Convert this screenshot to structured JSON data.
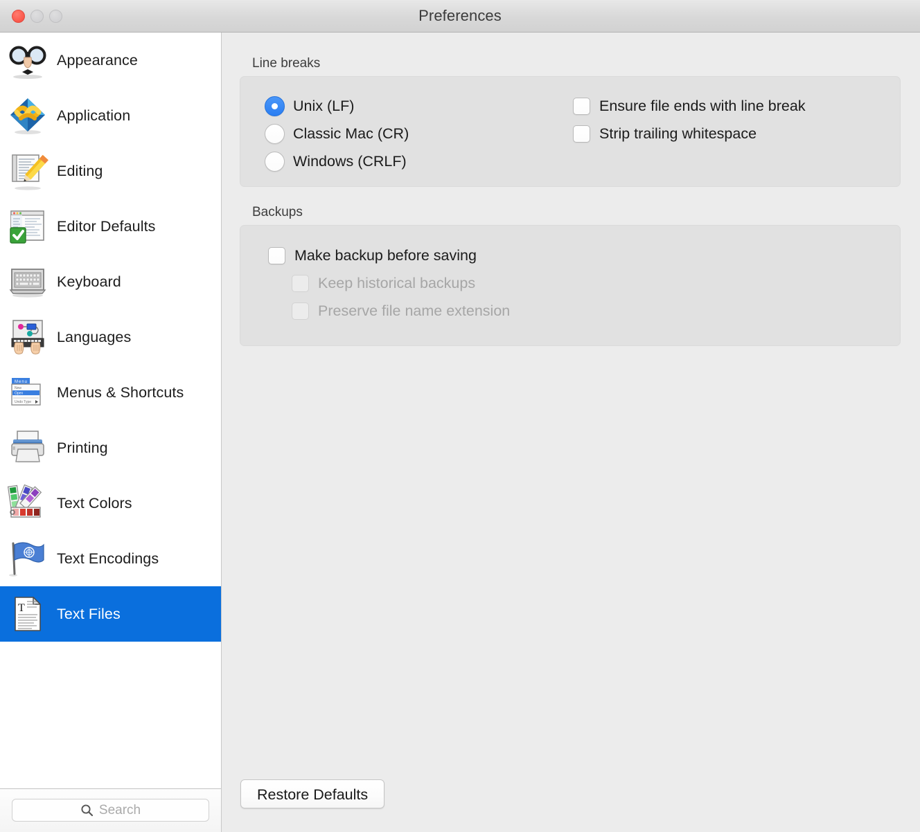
{
  "window": {
    "title": "Preferences",
    "traffic_lights": [
      {
        "name": "close",
        "color": "#fc5f52",
        "enabled": true
      },
      {
        "name": "minimize",
        "color": "#d4d4d6",
        "enabled": false
      },
      {
        "name": "zoom",
        "color": "#d4d4d6",
        "enabled": false
      }
    ]
  },
  "sidebar": {
    "selected_index": 10,
    "items": [
      {
        "label": "Appearance",
        "icon": "glasses-nose-icon"
      },
      {
        "label": "Application",
        "icon": "knot-diamond-icon"
      },
      {
        "label": "Editing",
        "icon": "pencil-document-icon"
      },
      {
        "label": "Editor Defaults",
        "icon": "window-checkmark-icon"
      },
      {
        "label": "Keyboard",
        "icon": "keyboard-icon"
      },
      {
        "label": "Languages",
        "icon": "hands-typing-icon"
      },
      {
        "label": "Menus & Shortcuts",
        "icon": "menu-dropdown-icon"
      },
      {
        "label": "Printing",
        "icon": "printer-icon"
      },
      {
        "label": "Text Colors",
        "icon": "color-swatches-icon"
      },
      {
        "label": "Text Encodings",
        "icon": "un-flag-icon"
      },
      {
        "label": "Text Files",
        "icon": "text-document-icon"
      }
    ],
    "selection_color": "#0a6fdd",
    "search": {
      "placeholder": "Search",
      "value": "",
      "icon": "search-icon"
    }
  },
  "main": {
    "sections": [
      {
        "title": "Line breaks",
        "radio_group": {
          "name": "line-break-style",
          "options": [
            {
              "label": "Unix (LF)",
              "checked": true
            },
            {
              "label": "Classic Mac (CR)",
              "checked": false
            },
            {
              "label": "Windows (CRLF)",
              "checked": false
            }
          ]
        },
        "checkboxes": [
          {
            "label": "Ensure file ends with line break",
            "checked": false,
            "enabled": true
          },
          {
            "label": "Strip trailing whitespace",
            "checked": false,
            "enabled": true
          }
        ]
      },
      {
        "title": "Backups",
        "checkboxes": [
          {
            "label": "Make backup before saving",
            "checked": false,
            "enabled": true,
            "indent": false
          },
          {
            "label": "Keep historical backups",
            "checked": false,
            "enabled": false,
            "indent": true
          },
          {
            "label": "Preserve file name extension",
            "checked": false,
            "enabled": false,
            "indent": true
          }
        ]
      }
    ],
    "restore_defaults_label": "Restore Defaults"
  },
  "colors": {
    "window_background": "#ececec",
    "group_background": "#e1e1e1",
    "sidebar_background": "#ffffff",
    "accent_blue": "#2a7ef2",
    "selection_blue": "#0a6fdd"
  }
}
